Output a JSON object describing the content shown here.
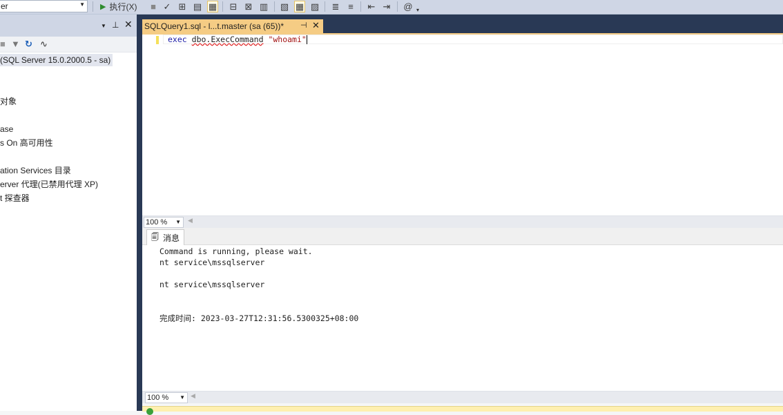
{
  "toolbar": {
    "database_value": "er",
    "execute_label": "执行(X)"
  },
  "explorer": {
    "tree": [
      "(SQL Server 15.0.2000.5 - sa)",
      "对象",
      "ase",
      "s On 高可用性",
      "ation Services 目录",
      "erver 代理(已禁用代理 XP)",
      "t 探查器"
    ]
  },
  "editor": {
    "tab_title": "SQLQuery1.sql - l...t.master (sa (65))*",
    "code": {
      "keyword": "exec",
      "object": "dbo.ExecCommand",
      "string": "\"whoami\""
    },
    "zoom": "100 %"
  },
  "results": {
    "tab_label": "消息",
    "lines": [
      "Command is running, please wait.",
      "nt service\\mssqlserver",
      "",
      "nt service\\mssqlserver",
      "",
      "",
      "完成时间: 2023-03-27T12:31:56.5300325+08:00"
    ],
    "zoom": "100 %"
  },
  "icons": [
    "play-icon",
    "stop-icon",
    "check-icon",
    "filter-icon",
    "refresh-icon",
    "activity-icon",
    "pin-icon",
    "close-icon",
    "messages-icon"
  ]
}
